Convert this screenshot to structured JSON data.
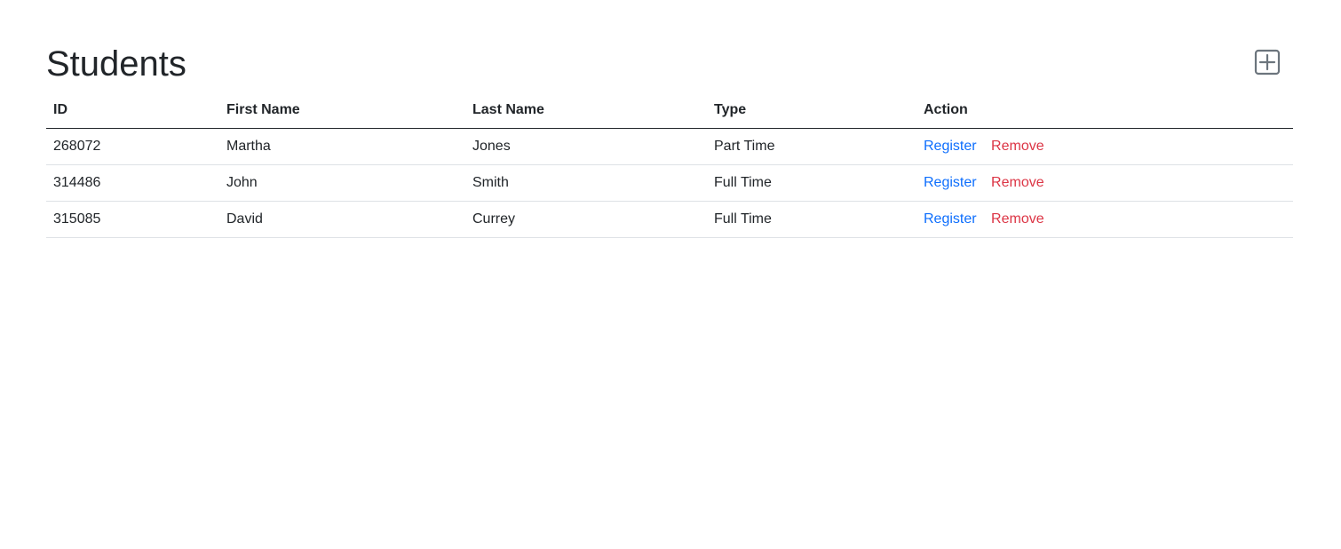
{
  "page": {
    "title": "Students"
  },
  "toolbar": {
    "add_icon": "plus-square-icon"
  },
  "table": {
    "headers": [
      "ID",
      "First Name",
      "Last Name",
      "Type",
      "Action"
    ],
    "rows": [
      {
        "id": "268072",
        "first_name": "Martha",
        "last_name": "Jones",
        "type": "Part Time",
        "register_label": "Register",
        "remove_label": "Remove"
      },
      {
        "id": "314486",
        "first_name": "John",
        "last_name": "Smith",
        "type": "Full Time",
        "register_label": "Register",
        "remove_label": "Remove"
      },
      {
        "id": "315085",
        "first_name": "David",
        "last_name": "Currey",
        "type": "Full Time",
        "register_label": "Register",
        "remove_label": "Remove"
      }
    ]
  },
  "colors": {
    "link": "#0d6efd",
    "danger": "#dc3545",
    "text": "#212529",
    "icon": "#6c757d"
  }
}
